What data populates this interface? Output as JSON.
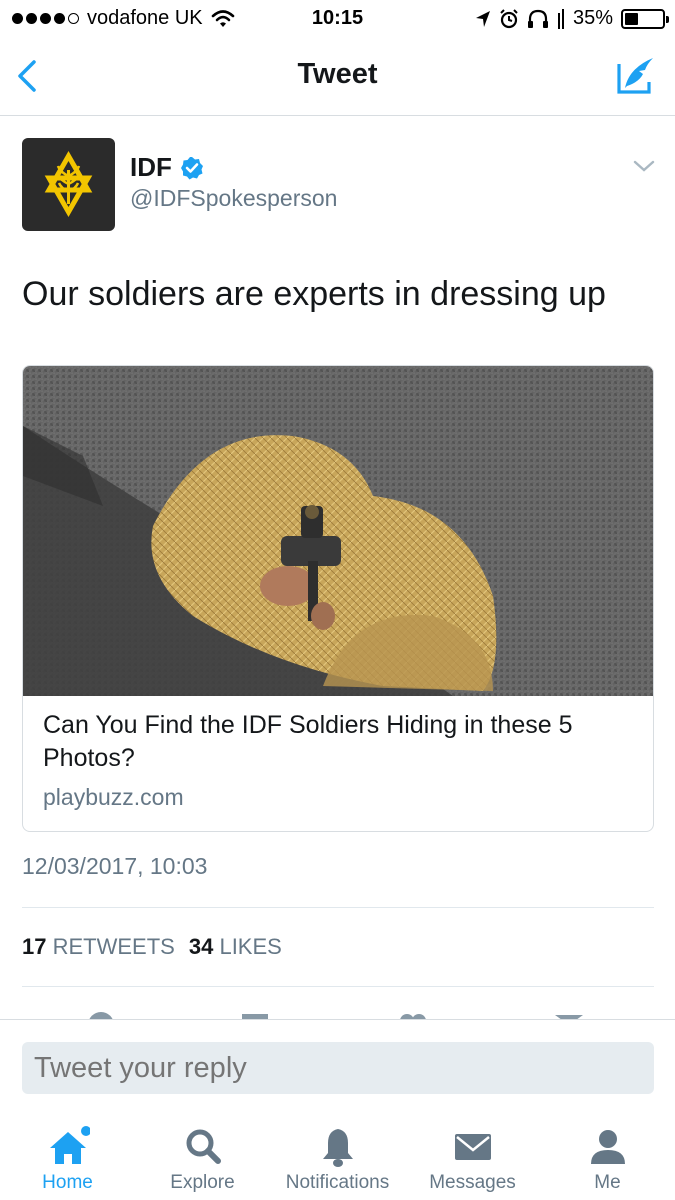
{
  "status_bar": {
    "carrier": "vodafone UK",
    "time": "10:15",
    "battery_percent": "35%",
    "battery_level": 0.35
  },
  "nav": {
    "title": "Tweet",
    "back_icon": "chevron-left-icon",
    "compose_icon": "compose-icon"
  },
  "tweet": {
    "author_name": "IDF",
    "author_handle": "@IDFSpokesperson",
    "verified": true,
    "text": "Our soldiers are experts in dressing up",
    "card": {
      "title": "Can You Find the IDF Soldiers Hiding in these 5 Photos?",
      "domain": "playbuzz.com"
    },
    "timestamp": "12/03/2017, 10:03",
    "retweets_count": "17",
    "retweets_label": "RETWEETS",
    "likes_count": "34",
    "likes_label": "LIKES"
  },
  "reply": {
    "placeholder": "Tweet your reply"
  },
  "tabs": [
    {
      "label": "Home",
      "icon": "home-icon",
      "active": true
    },
    {
      "label": "Explore",
      "icon": "search-icon",
      "active": false
    },
    {
      "label": "Notifications",
      "icon": "bell-icon",
      "active": false
    },
    {
      "label": "Messages",
      "icon": "envelope-icon",
      "active": false
    },
    {
      "label": "Me",
      "icon": "person-icon",
      "active": false
    }
  ],
  "colors": {
    "accent": "#1da1f2",
    "text_primary": "#14171a",
    "text_secondary": "#657786",
    "border": "#e1e8ed"
  }
}
